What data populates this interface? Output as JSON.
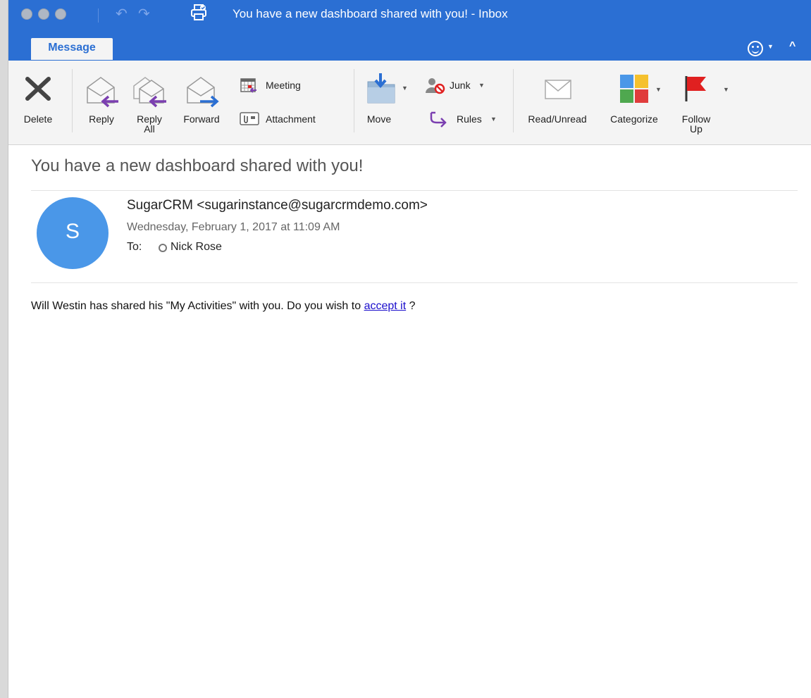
{
  "window": {
    "title": "You have a new dashboard shared with you! - Inbox"
  },
  "titlebar": {
    "undo_icon": "undo-icon",
    "redo_icon": "redo-icon",
    "print_icon": "print-icon"
  },
  "ribbon": {
    "tab": "Message",
    "delete": "Delete",
    "reply": "Reply",
    "reply_all_1": "Reply",
    "reply_all_2": "All",
    "forward": "Forward",
    "meeting": "Meeting",
    "attachment": "Attachment",
    "move": "Move",
    "junk": "Junk",
    "rules": "Rules",
    "read_unread": "Read/Unread",
    "categorize": "Categorize",
    "follow_up_1": "Follow",
    "follow_up_2": "Up",
    "colors": {
      "accent": "#2b6fd3",
      "reply_arrow": "#7b3fb0",
      "forward_arrow": "#2b6fd3",
      "flag": "#e02020"
    }
  },
  "message": {
    "subject": "You have a new dashboard shared with you!",
    "avatar_letter": "S",
    "from": "SugarCRM <sugarinstance@sugarcrmdemo.com>",
    "date": "Wednesday, February 1, 2017 at 11:09 AM",
    "to_label": "To:",
    "recipient": "Nick Rose",
    "body_before_link": "Will Westin has shared his \"My Activities\" with you. Do you wish to ",
    "link_text": "accept it",
    "body_after_link": " ?"
  }
}
